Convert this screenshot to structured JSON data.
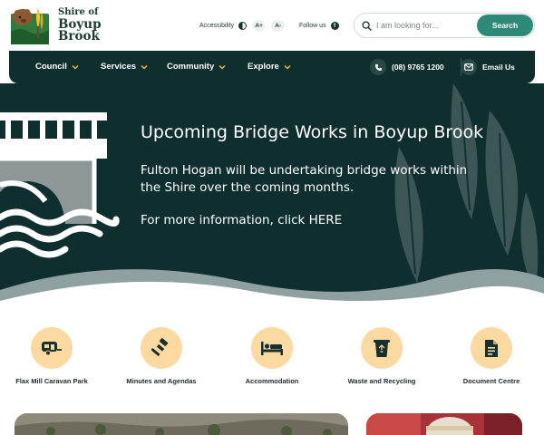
{
  "site": {
    "logo_small": "Shire of",
    "logo_big": "Boyup Brook"
  },
  "utility": {
    "accessibility_label": "Accessibility",
    "text_increase_label": "A+",
    "text_decrease_label": "A-",
    "follow_label": "Follow us",
    "facebook_glyph": "f"
  },
  "search": {
    "placeholder": "I am looking for...",
    "value": "",
    "button_label": "Search"
  },
  "nav": {
    "items": [
      {
        "label": "Council"
      },
      {
        "label": "Services"
      },
      {
        "label": "Community"
      },
      {
        "label": "Explore"
      }
    ],
    "phone": "(08) 9765 1200",
    "email_label": "Email Us"
  },
  "hero": {
    "title": "Upcoming Bridge Works in Boyup Brook",
    "text": "Fulton Hogan will be undertaking bridge works within the Shire over the coming months.",
    "link": "For more information, click HERE"
  },
  "quick_links": [
    {
      "label": "Flax Mill Caravan Park",
      "icon": "caravan-icon"
    },
    {
      "label": "Minutes and Agendas",
      "icon": "gavel-icon"
    },
    {
      "label": "Accommodation",
      "icon": "bed-icon"
    },
    {
      "label": "Waste and Recycling",
      "icon": "recycle-bin-icon"
    },
    {
      "label": "Document Centre",
      "icon": "document-icon"
    }
  ],
  "colors": {
    "dark_teal": "#0f2f2f",
    "accent_green": "#2e8a78",
    "peach": "#fdd9a2",
    "icon_dark": "#16302f",
    "chevron_gold": "#f2b33d"
  }
}
